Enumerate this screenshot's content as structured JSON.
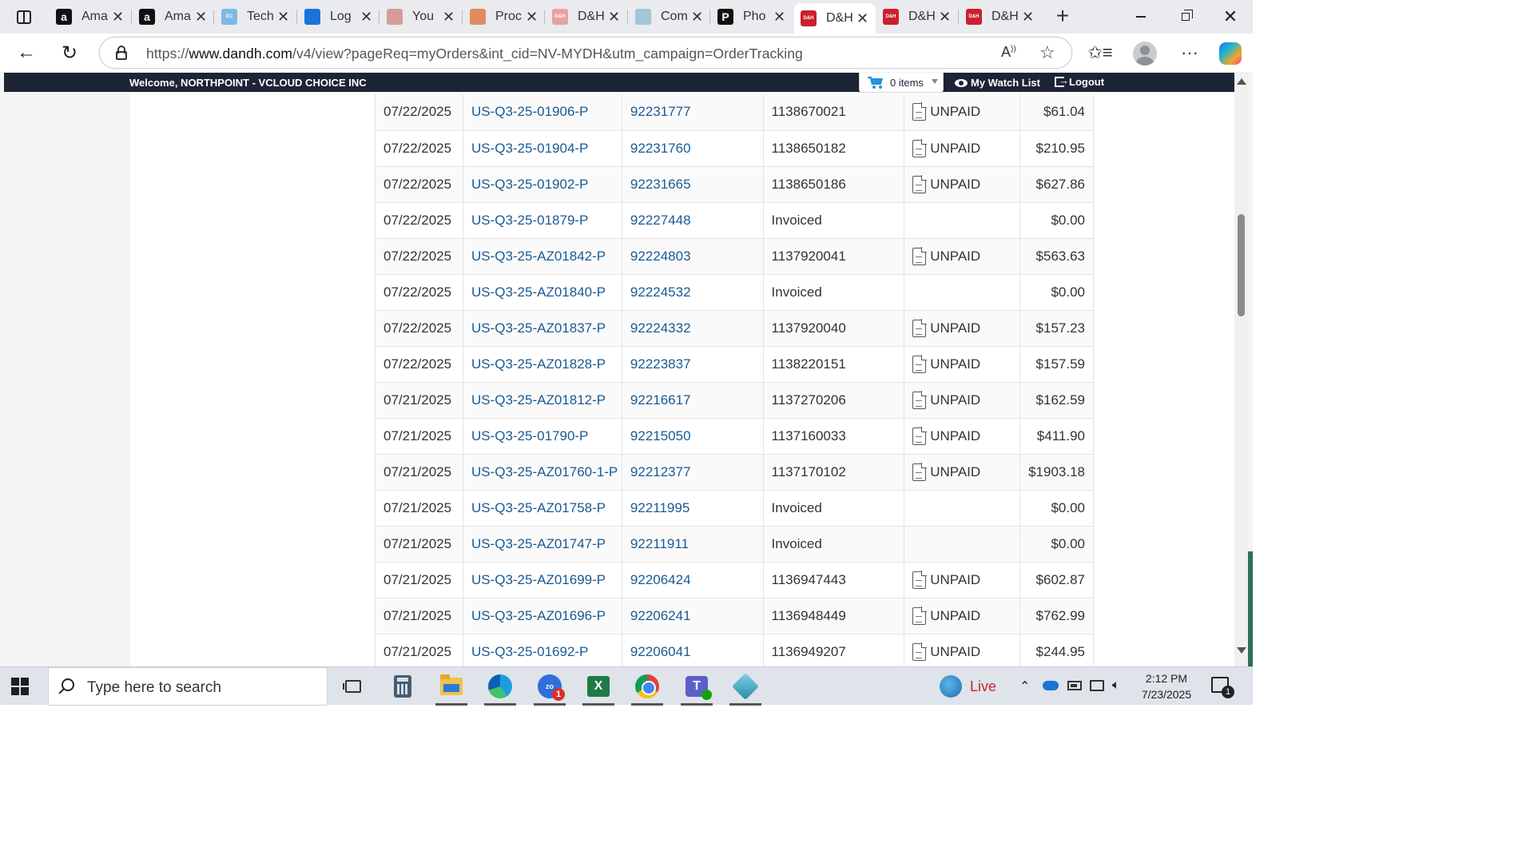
{
  "browser": {
    "tabs": [
      {
        "title": "Ama",
        "favicon": "amazon-icon",
        "favicon_text": "a",
        "color": "#111111"
      },
      {
        "title": "Ama",
        "favicon": "amazon-icon",
        "favicon_text": "a",
        "color": "#111111"
      },
      {
        "title": "Tech",
        "favicon": "ec-icon",
        "favicon_text": "EC",
        "color": "#7fb8e0"
      },
      {
        "title": "Log",
        "favicon": "login-icon",
        "favicon_text": "",
        "color": "#1a73d9"
      },
      {
        "title": "You",
        "favicon": "people-icon",
        "favicon_text": "",
        "color": "#d99a9a"
      },
      {
        "title": "Proc",
        "favicon": "swirl-icon",
        "favicon_text": "",
        "color": "#e08c5c"
      },
      {
        "title": "D&H",
        "favicon": "dandh-icon",
        "favicon_text": "D&H",
        "color": "#e8a0a0"
      },
      {
        "title": "Com",
        "favicon": "globe-icon",
        "favicon_text": "",
        "color": "#9fc7d6"
      },
      {
        "title": "Pho",
        "favicon": "p-icon",
        "favicon_text": "P",
        "color": "#111111"
      },
      {
        "title": "D&H",
        "favicon": "dandh-icon",
        "favicon_text": "D&H",
        "color": "#cc1f2d",
        "active": true
      },
      {
        "title": "D&H",
        "favicon": "dandh-icon",
        "favicon_text": "D&H",
        "color": "#cc1f2d"
      },
      {
        "title": "D&H",
        "favicon": "dandh-icon",
        "favicon_text": "D&H",
        "color": "#cc1f2d"
      }
    ],
    "url_prefix": "https://",
    "url_host": "www.dandh.com",
    "url_path": "/v4/view?pageReq=myOrders&int_cid=NV-MYDH&utm_campaign=OrderTracking"
  },
  "site": {
    "welcome": "Welcome, NORTHPOINT - VCLOUD CHOICE INC",
    "cart_label": "0 items",
    "watch_list": "My Watch List",
    "logout": "Logout",
    "topbar_color": "#1c2436",
    "link_color": "#1a5a93"
  },
  "orders": [
    {
      "date": "07/22/2025",
      "po": "US-Q3-25-01906-P",
      "order": "92231777",
      "invoice": "1138670021",
      "status": "UNPAID",
      "amount": "$61.04"
    },
    {
      "date": "07/22/2025",
      "po": "US-Q3-25-01904-P",
      "order": "92231760",
      "invoice": "1138650182",
      "status": "UNPAID",
      "amount": "$210.95"
    },
    {
      "date": "07/22/2025",
      "po": "US-Q3-25-01902-P",
      "order": "92231665",
      "invoice": "1138650186",
      "status": "UNPAID",
      "amount": "$627.86"
    },
    {
      "date": "07/22/2025",
      "po": "US-Q3-25-01879-P",
      "order": "92227448",
      "invoice": "Invoiced",
      "status": "",
      "amount": "$0.00"
    },
    {
      "date": "07/22/2025",
      "po": "US-Q3-25-AZ01842-P",
      "order": "92224803",
      "invoice": "1137920041",
      "status": "UNPAID",
      "amount": "$563.63"
    },
    {
      "date": "07/22/2025",
      "po": "US-Q3-25-AZ01840-P",
      "order": "92224532",
      "invoice": "Invoiced",
      "status": "",
      "amount": "$0.00"
    },
    {
      "date": "07/22/2025",
      "po": "US-Q3-25-AZ01837-P",
      "order": "92224332",
      "invoice": "1137920040",
      "status": "UNPAID",
      "amount": "$157.23"
    },
    {
      "date": "07/22/2025",
      "po": "US-Q3-25-AZ01828-P",
      "order": "92223837",
      "invoice": "1138220151",
      "status": "UNPAID",
      "amount": "$157.59"
    },
    {
      "date": "07/21/2025",
      "po": "US-Q3-25-AZ01812-P",
      "order": "92216617",
      "invoice": "1137270206",
      "status": "UNPAID",
      "amount": "$162.59"
    },
    {
      "date": "07/21/2025",
      "po": "US-Q3-25-01790-P",
      "order": "92215050",
      "invoice": "1137160033",
      "status": "UNPAID",
      "amount": "$411.90"
    },
    {
      "date": "07/21/2025",
      "po": "US-Q3-25-AZ01760-1-P",
      "order": "92212377",
      "invoice": "1137170102",
      "status": "UNPAID",
      "amount": "$1903.18"
    },
    {
      "date": "07/21/2025",
      "po": "US-Q3-25-AZ01758-P",
      "order": "92211995",
      "invoice": "Invoiced",
      "status": "",
      "amount": "$0.00"
    },
    {
      "date": "07/21/2025",
      "po": "US-Q3-25-AZ01747-P",
      "order": "92211911",
      "invoice": "Invoiced",
      "status": "",
      "amount": "$0.00"
    },
    {
      "date": "07/21/2025",
      "po": "US-Q3-25-AZ01699-P",
      "order": "92206424",
      "invoice": "1136947443",
      "status": "UNPAID",
      "amount": "$602.87"
    },
    {
      "date": "07/21/2025",
      "po": "US-Q3-25-AZ01696-P",
      "order": "92206241",
      "invoice": "1136948449",
      "status": "UNPAID",
      "amount": "$762.99"
    },
    {
      "date": "07/21/2025",
      "po": "US-Q3-25-01692-P",
      "order": "92206041",
      "invoice": "1136949207",
      "status": "UNPAID",
      "amount": "$244.95"
    }
  ],
  "taskbar": {
    "search_placeholder": "Type here to search",
    "zoho_label": "zo",
    "zoho_badge": "1",
    "excel_label": "X",
    "teams_label": "T",
    "weather_label": "Live",
    "time": "2:12 PM",
    "date": "7/23/2025",
    "notification_count": "1"
  }
}
